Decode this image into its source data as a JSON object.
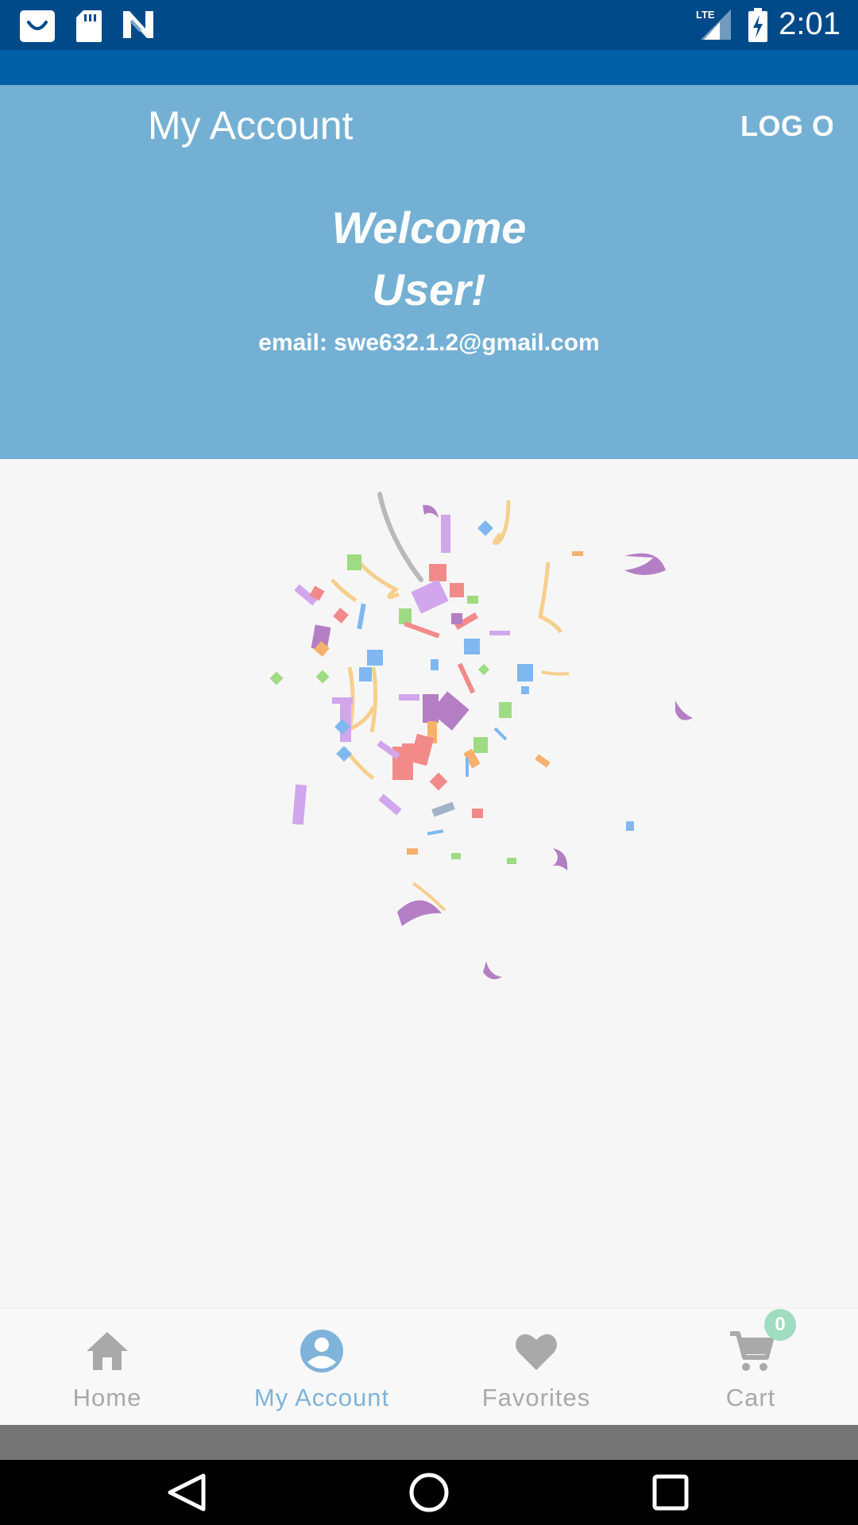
{
  "status_bar": {
    "time": "2:01",
    "left_icons": [
      "shopping-bag-icon",
      "sd-card-icon",
      "n-logo-icon"
    ],
    "right_icons": [
      "lte-signal-icon",
      "battery-charging-icon"
    ],
    "network_label": "LTE",
    "background": "#004a8a"
  },
  "app_bar": {
    "title": "My Account",
    "logout_label": "LOG OUT",
    "background": "#74b0d4"
  },
  "welcome": {
    "line1": "Welcome",
    "line2": "User!",
    "email": "email: swe632.1.2@gmail.com"
  },
  "content": {
    "decoration": "confetti-animation"
  },
  "bottom_nav": {
    "items": [
      {
        "label": "Home",
        "icon": "home-icon",
        "active": false
      },
      {
        "label": "My Account",
        "icon": "account-circle-icon",
        "active": true
      },
      {
        "label": "Favorites",
        "icon": "heart-icon",
        "active": false
      },
      {
        "label": "Cart",
        "icon": "cart-icon",
        "active": false
      }
    ],
    "cart_count": "0",
    "active_color": "#7fb3d9",
    "inactive_color": "#a9a9a9",
    "badge_color": "#9fdcc0"
  },
  "system_nav": {
    "buttons": [
      "back-icon",
      "home-circle-icon",
      "recents-icon"
    ]
  }
}
